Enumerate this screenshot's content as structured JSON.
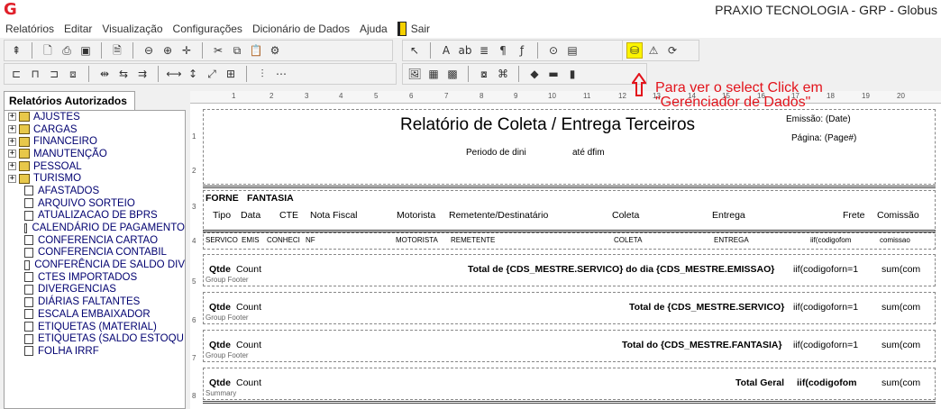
{
  "window": {
    "title": "PRAXIO TECNOLOGIA - GRP - Globus"
  },
  "menu": [
    "Relatórios",
    "Editar",
    "Visualização",
    "Configurações",
    "Dicionário de Dados",
    "Ajuda",
    "Sair"
  ],
  "toolbar_icons": {
    "t1": [
      "align-top-icon",
      "new-icon",
      "print-icon",
      "save-icon",
      "preview-icon",
      "zoom-in-icon",
      "zoom-out-icon",
      "zoom-fit-icon",
      "cut-icon",
      "copy-icon",
      "paste-icon",
      "page-setup-icon"
    ],
    "t2": [
      "select-pointer-icon",
      "label-icon",
      "field-icon",
      "memo-icon",
      "richtext-icon",
      "line-icon",
      "expression-icon",
      "sysdata-icon",
      "sql-icon",
      "database-icon",
      "refresh-icon"
    ]
  },
  "panel": {
    "tab_label": "Relatórios Autorizados"
  },
  "tree": {
    "folders": [
      "AJUSTES",
      "CARGAS",
      "FINANCEIRO",
      "MANUTENÇÃO",
      "PESSOAL",
      "TURISMO"
    ],
    "items": [
      "AFASTADOS",
      "ARQUIVO SORTEIO",
      "ATUALIZACAO DE BPRS",
      "CALENDÁRIO DE PAGAMENTO",
      "CONFERENCIA CARTAO",
      "CONFERENCIA CONTABIL",
      "CONFERÊNCIA DE SALDO DIV",
      "CTES IMPORTADOS",
      "DIVERGENCIAS",
      "DIÁRIAS FALTANTES",
      "ESCALA EMBAIXADOR",
      "ETIQUETAS (MATERIAL)",
      "ETIQUETAS (SALDO ESTOQU",
      "FOLHA IRRF"
    ]
  },
  "ruler": {
    "h": [
      "1",
      "2",
      "3",
      "4",
      "5",
      "6",
      "7",
      "8",
      "9",
      "10",
      "11",
      "12",
      "13",
      "14",
      "15",
      "16",
      "17",
      "18",
      "19",
      "20"
    ],
    "v": [
      "1",
      "2",
      "3",
      "4",
      "5",
      "6",
      "7",
      "8"
    ]
  },
  "callout": {
    "line1": "Para ver o select Click em",
    "line2": "\"Gerenciador de Dados\""
  },
  "report": {
    "title": "Relatório de Coleta / Entrega Terceiros",
    "emissao": "Emissão: (Date)",
    "pagina": "Página: (Page#)",
    "periodo": "Periodo de dini",
    "ate": "até dfim",
    "forne": "FORNE",
    "fantasia": "FANTASIA",
    "columns": [
      "Tipo",
      "Data",
      "CTE",
      "Nota Fiscal",
      "Motorista",
      "Remetente/Destinatário",
      "Coleta",
      "Entrega",
      "Frete",
      "Comissão"
    ],
    "detail_fields": [
      "SERVICO",
      "EMIS",
      "CONHECI",
      "NF",
      "MOTORISTA",
      "REMETENTE",
      "COLETA",
      "ENTREGA",
      "iif(codigofom",
      "comissao"
    ],
    "band_tag": "Group Footer",
    "summary_tag": "Summary",
    "qtde": "Qtde",
    "count": "Count",
    "footers": [
      {
        "label": "Total de {CDS_MESTRE.SERVICO} do dia {CDS_MESTRE.EMISSAO}",
        "iif": "iif(codigoforn=1",
        "sum": "sum(com"
      },
      {
        "label": "Total de {CDS_MESTRE.SERVICO}",
        "iif": "iif(codigoforn=1",
        "sum": "sum(com"
      },
      {
        "label": "Total do {CDS_MESTRE.FANTASIA}",
        "iif": "iif(codigoforn=1",
        "sum": "sum(com"
      },
      {
        "label": "Total Geral",
        "iif": "iif(codigofom",
        "sum": "sum(com"
      }
    ]
  },
  "colors": {
    "accent_red": "#e3141c",
    "tree_text": "#000070",
    "highlight": "#fbf400"
  }
}
